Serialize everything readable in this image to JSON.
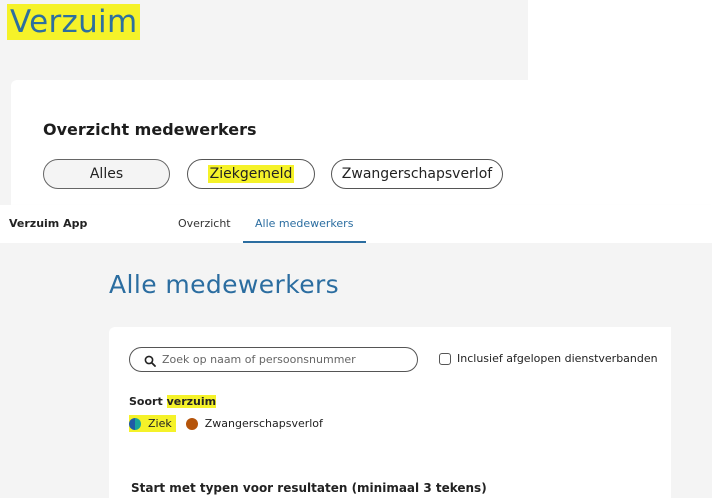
{
  "top_panel": {
    "title": "Verzuim",
    "card_title": "Overzicht medewerkers",
    "filters": [
      "Alles",
      "Ziekgemeld",
      "Zwangerschapsverlof"
    ]
  },
  "header": {
    "brand": "Verzuim App",
    "tabs": [
      {
        "label": "Overzicht",
        "active": false
      },
      {
        "label": "Alle medewerkers",
        "active": true
      }
    ]
  },
  "main": {
    "title": "Alle medewerkers",
    "search": {
      "placeholder": "Zoek op naam of persoonsnummer",
      "value": ""
    },
    "checkbox": {
      "label": "Inclusief afgelopen dienstverbanden",
      "checked": false
    },
    "soort": {
      "label_prefix": "Soort ",
      "label_highlight": "verzuim",
      "items": [
        {
          "label": "Ziek",
          "color": "#1f5aa6"
        },
        {
          "label": "Zwangerschapsverlof",
          "color": "#b5540a"
        }
      ]
    },
    "hint": "Start met typen voor resultaten (minimaal 3 tekens)"
  },
  "colors": {
    "accent": "#2b6da0",
    "highlight": "#f5f229"
  }
}
